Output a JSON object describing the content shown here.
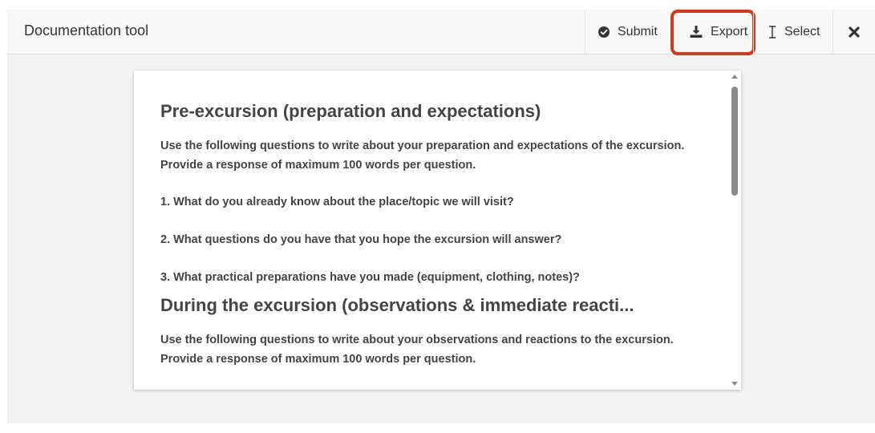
{
  "header": {
    "title": "Documentation tool",
    "toolbar": {
      "submit_label": "Submit",
      "export_label": "Export",
      "select_label": "Select",
      "submit_icon": "check-circle-icon",
      "export_icon": "download-icon",
      "select_icon": "text-cursor-icon",
      "close_icon": "close-icon"
    },
    "highlight_color": "#cf3b1e"
  },
  "document": {
    "section1": {
      "heading": "Pre-excursion (preparation and expectations)",
      "intro": "Use the following questions to write about your preparation and expectations of the excursion. Provide a response of maximum 100 words per question.",
      "questions": [
        "1. What do you already know about the place/topic we will visit?",
        "2. What questions do you have that you hope the excursion will answer?",
        "3. What practical preparations have you made (equipment, clothing, notes)?"
      ]
    },
    "section2": {
      "heading": "During the excursion (observations & immediate reacti...",
      "intro": "Use the following questions to write about your observations and reactions to the excursion. Provide a response of maximum 100 words per question."
    }
  }
}
